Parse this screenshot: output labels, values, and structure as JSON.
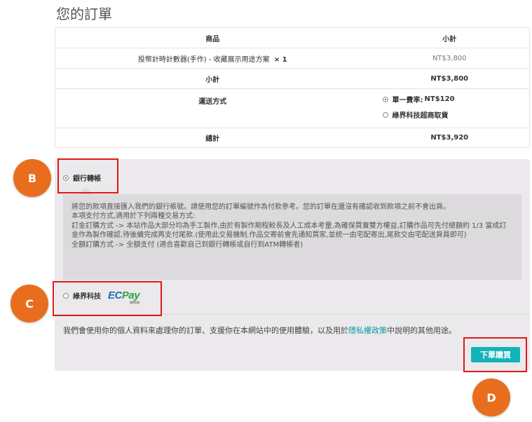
{
  "page_title": "您的訂單",
  "order_table": {
    "header_product": "商品",
    "header_subtotal": "小計",
    "item": {
      "name": "投幣計時計數器(手作) - 收藏展示用途方案",
      "qty": "× 1",
      "price": "NT$3,800"
    },
    "subtotal_label": "小計",
    "subtotal_value": "NT$3,800",
    "shipping_label": "運送方式",
    "shipping_options": [
      {
        "label": "單一費率:",
        "price": "NT$120",
        "selected": true
      },
      {
        "label": "綠界科技超商取貨",
        "price": "",
        "selected": false
      }
    ],
    "total_label": "總計",
    "total_value": "NT$3,920"
  },
  "payment": {
    "bank_transfer_label": "銀行轉帳",
    "bank_transfer_selected": true,
    "bank_description": [
      "將您的款項直接匯入我們的銀行帳號。請使用您的訂單編號作為付款參考。您的訂單在還沒有確認收到款項之前不會出貨。",
      "本項支付方式,適用於下列兩種交易方式:",
      "訂金訂購方式 -> 本站作品大部分均為手工製作,由於有製作期程較長及人工成本考量,為確保買賣雙方權益,訂購作品可先付總額約 1/3 當成訂金作為製作確認,待後續完成再支付尾款.(使用此交易機制,作品交寄前會先通知買家,並統一由宅配寄出,尾款交由宅配送貨員即可)",
      "全額訂購方式 -> 全額支付 (適合喜歡自己到銀行轉帳或自行到ATM轉帳者)"
    ],
    "ecpay_label": "綠界科技",
    "ecpay_logo": {
      "ec": "EC",
      "pay": "Pay",
      "sub": "綠界科技"
    },
    "ecpay_selected": false,
    "privacy_before": "我們會使用你的個人資料來處理你的訂單、支援你在本網站中的使用體驗，以及用於",
    "privacy_link": "隱私權政策",
    "privacy_after": "中說明的其他用途。",
    "place_order_label": "下單購買"
  },
  "annotations": {
    "markers": [
      "B",
      "C",
      "D"
    ],
    "marker_color": "#e86e1e",
    "box_color": "#dd1a1a"
  },
  "colors": {
    "accent": "#13b3b8",
    "link": "#0a9aa8",
    "ecpay_blue": "#1c6fb6",
    "ecpay_green": "#2ea345"
  }
}
